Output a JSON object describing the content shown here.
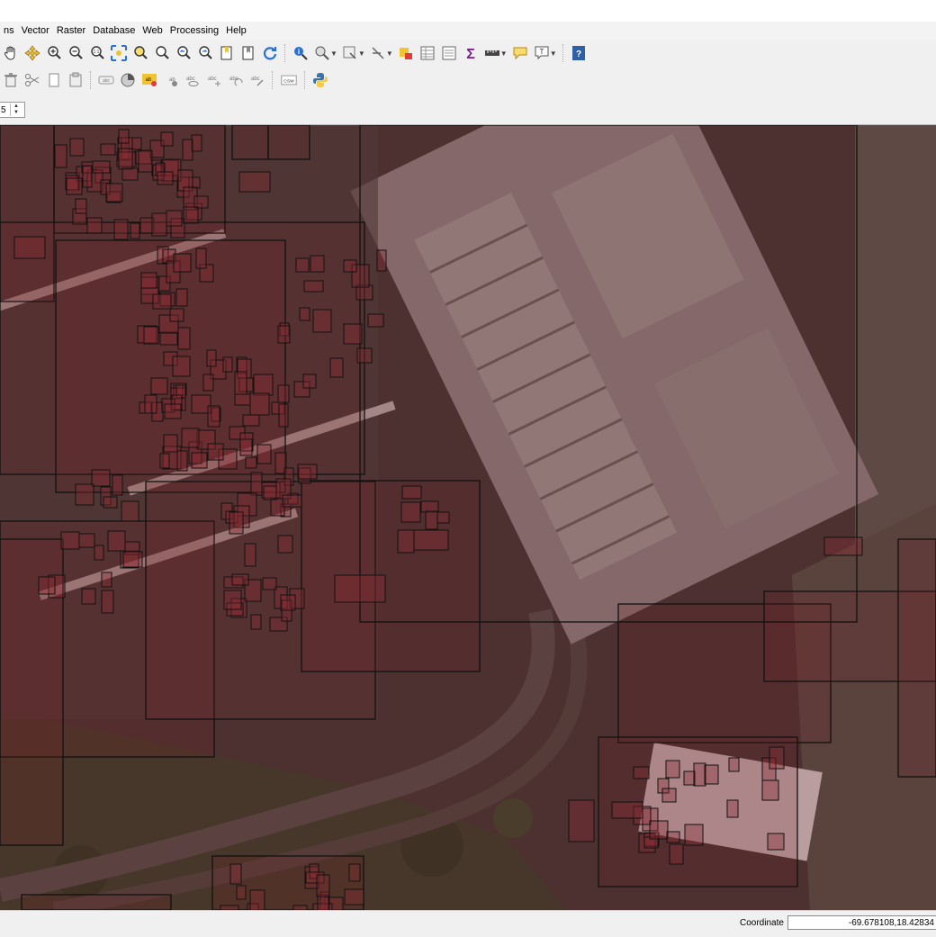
{
  "menu": [
    "ns",
    "Vector",
    "Raster",
    "Database",
    "Web",
    "Processing",
    "Help"
  ],
  "toolbar1": {
    "icons": [
      "pan-icon",
      "pan-to-selection-icon",
      "zoom-in-icon",
      "zoom-out-icon",
      "zoom-native-icon",
      "zoom-full-icon",
      "zoom-to-selection-icon",
      "zoom-to-layer-icon",
      "zoom-last-icon",
      "zoom-next-icon",
      "new-bookmark-icon",
      "show-bookmarks-icon",
      "refresh-icon",
      "identify-icon",
      "select-features-icon",
      "select-by-value-icon",
      "deselect-icon",
      "attribute-table-icon",
      "field-calculator-icon",
      "statistics-icon",
      "measure-icon",
      "map-tips-icon",
      "text-annotation-icon",
      "help-icon"
    ]
  },
  "toolbar2": {
    "icons": [
      "delete-icon",
      "cut-icon",
      "copy-icon",
      "paste-icon",
      "label-icon",
      "layer-diagram-icon",
      "highlight-pin-label-icon",
      "pin-label-icon",
      "show-hide-label-icon",
      "move-label-icon",
      "rotate-label-icon",
      "change-label-icon",
      "csw-icon",
      "python-icon"
    ],
    "csw_label": "CSW"
  },
  "spinbox": {
    "value": "5"
  },
  "status": {
    "coordinate_label": "Coordinate",
    "coordinate_value": "-69.678108,18.42834"
  },
  "colors": {
    "overlay": "#6b1b22",
    "box_stroke": "#111111",
    "roof": "#8f8787",
    "asphalt": "#3c3835",
    "vegetation": "#3b4232",
    "help": "#2f5fa6",
    "sum": "#7a1a8a"
  }
}
